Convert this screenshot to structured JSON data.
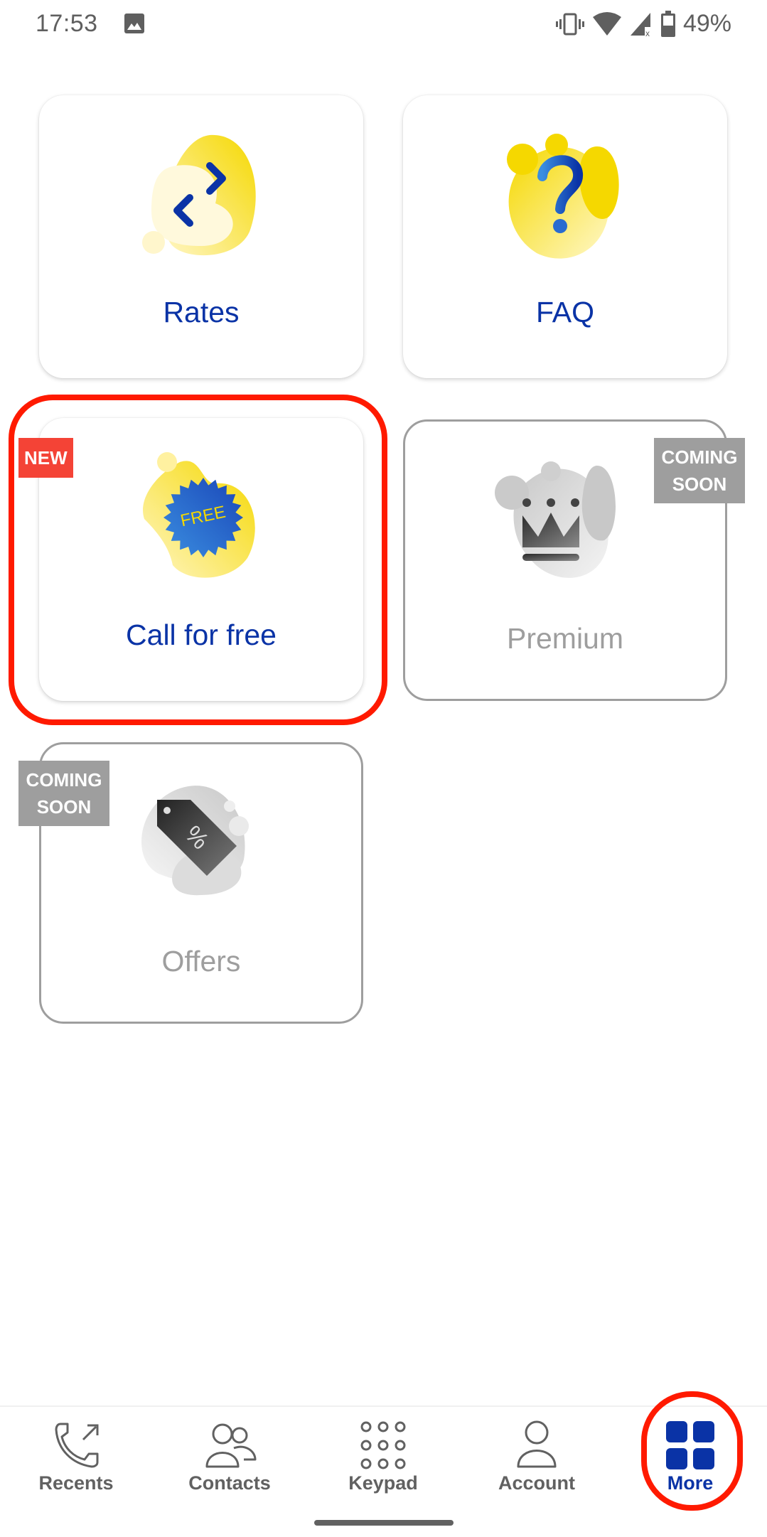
{
  "status_bar": {
    "time": "17:53",
    "left_icons": [
      "image-notification-icon"
    ],
    "right_icons": [
      "vibrate-icon",
      "wifi-icon",
      "cellular-no-data-icon",
      "battery-icon"
    ],
    "battery": "49%"
  },
  "tiles": [
    {
      "label": "Rates",
      "icon": "exchange-arrows-icon",
      "state": "enabled",
      "badge": null
    },
    {
      "label": "FAQ",
      "icon": "question-mark-icon",
      "state": "enabled",
      "badge": null
    },
    {
      "label": "Call for free",
      "icon": "free-badge-icon",
      "icon_text": "FREE",
      "state": "enabled",
      "badge": "NEW",
      "highlighted": true
    },
    {
      "label": "Premium",
      "icon": "crown-icon",
      "state": "disabled",
      "badge": "COMING SOON"
    },
    {
      "label": "Offers",
      "icon": "discount-tag-icon",
      "icon_text": "%",
      "state": "disabled",
      "badge": "COMING SOON"
    }
  ],
  "badges": {
    "new": "NEW",
    "coming_line1": "COMING",
    "coming_line2": "SOON"
  },
  "bottom_nav": {
    "items": [
      {
        "label": "Recents",
        "icon": "recent-calls-icon",
        "active": false
      },
      {
        "label": "Contacts",
        "icon": "contacts-icon",
        "active": false
      },
      {
        "label": "Keypad",
        "icon": "keypad-icon",
        "active": false
      },
      {
        "label": "Account",
        "icon": "account-icon",
        "active": false
      },
      {
        "label": "More",
        "icon": "grid-more-icon",
        "active": true,
        "highlighted": true
      }
    ]
  },
  "colors": {
    "brand_blue": "#0a33a6",
    "brand_yellow": "#f5d800",
    "new_badge": "#f44336",
    "coming_soon_badge": "#9e9e9e",
    "highlight_red": "#ff1a00"
  }
}
